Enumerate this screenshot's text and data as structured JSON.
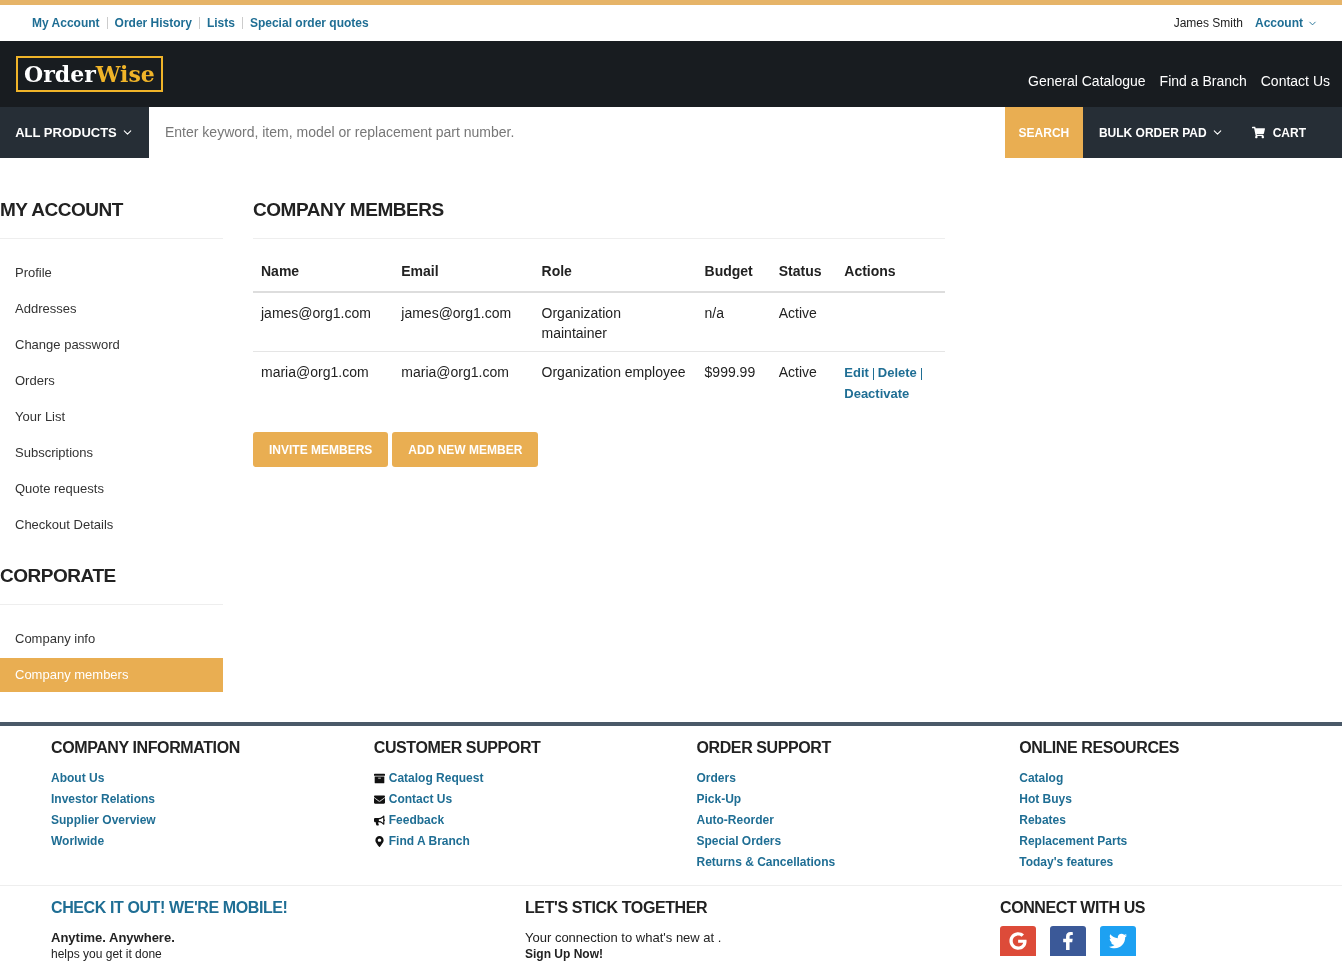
{
  "top_links": [
    "My Account",
    "Order History",
    "Lists",
    "Special order quotes"
  ],
  "user": {
    "name": "James Smith",
    "account": "Account"
  },
  "logo": {
    "part1": "Order",
    "part2": "Wise"
  },
  "header_links": [
    "General Catalogue",
    "Find a Branch",
    "Contact Us"
  ],
  "nav": {
    "all_products": "ALL PRODUCTS",
    "search_placeholder": "Enter keyword, item, model or replacement part number.",
    "search": "SEARCH",
    "bulk": "BULK ORDER PAD",
    "cart": "CART"
  },
  "sidebar": [
    {
      "title": "MY ACCOUNT",
      "items": [
        {
          "label": "Profile",
          "selected": false
        },
        {
          "label": "Addresses",
          "selected": false
        },
        {
          "label": "Change password",
          "selected": false
        },
        {
          "label": "Orders",
          "selected": false
        },
        {
          "label": "Your List",
          "selected": false
        },
        {
          "label": "Subscriptions",
          "selected": false
        },
        {
          "label": "Quote requests",
          "selected": false
        },
        {
          "label": "Checkout Details",
          "selected": false
        }
      ]
    },
    {
      "title": "CORPORATE",
      "items": [
        {
          "label": "Company info",
          "selected": false
        },
        {
          "label": "Company members",
          "selected": true
        }
      ]
    }
  ],
  "main": {
    "title": "COMPANY MEMBERS",
    "table": {
      "columns": [
        "Name",
        "Email",
        "Role",
        "Budget",
        "Status",
        "Actions"
      ],
      "rows": [
        {
          "cells": [
            "james@org1.com",
            "james@org1.com",
            "Organization maintainer",
            "n/a",
            "Active"
          ],
          "actions": []
        },
        {
          "cells": [
            "maria@org1.com",
            "maria@org1.com",
            "Organization employee",
            "$999.99",
            "Active"
          ],
          "actions": [
            "Edit",
            "Delete",
            "Deactivate"
          ]
        }
      ]
    },
    "buttons": [
      "INVITE MEMBERS",
      "ADD NEW MEMBER"
    ]
  },
  "footer": {
    "columns": [
      {
        "title": "COMPANY INFORMATION",
        "links": [
          {
            "label": "About Us"
          },
          {
            "label": "Investor Relations"
          },
          {
            "label": "Supplier Overview"
          },
          {
            "label": "Worlwide"
          }
        ]
      },
      {
        "title": "CUSTOMER SUPPORT",
        "links": [
          {
            "label": "Catalog Request",
            "kind": "archive"
          },
          {
            "label": "Contact Us",
            "kind": "envelope"
          },
          {
            "label": "Feedback",
            "kind": "megaphone"
          },
          {
            "label": "Find A Branch",
            "kind": "pin"
          }
        ]
      },
      {
        "title": "ORDER SUPPORT",
        "links": [
          {
            "label": "Orders"
          },
          {
            "label": "Pick-Up"
          },
          {
            "label": "Auto-Reorder"
          },
          {
            "label": "Special Orders"
          },
          {
            "label": "Returns & Cancellations"
          }
        ]
      },
      {
        "title": "ONLINE RESOURCES",
        "links": [
          {
            "label": "Catalog"
          },
          {
            "label": "Hot Buys"
          },
          {
            "label": "Rebates"
          },
          {
            "label": "Replacement Parts"
          },
          {
            "label": "Today's features"
          }
        ]
      }
    ],
    "mobile": {
      "title": "CHECK IT OUT! WE'RE MOBILE!",
      "tagline": "Anytime. Anywhere.",
      "text": "helps you get it done"
    },
    "stick": {
      "title": "LET'S STICK TOGETHER",
      "text": "Your connection to what's new at .",
      "signup": "Sign Up Now!"
    },
    "connect": {
      "title": "CONNECT WITH US",
      "socials": [
        {
          "kind": "google",
          "color": "#dd4b39"
        },
        {
          "kind": "facebook",
          "color": "#3b5998"
        },
        {
          "kind": "twitter",
          "color": "#1da1f2"
        }
      ]
    }
  }
}
